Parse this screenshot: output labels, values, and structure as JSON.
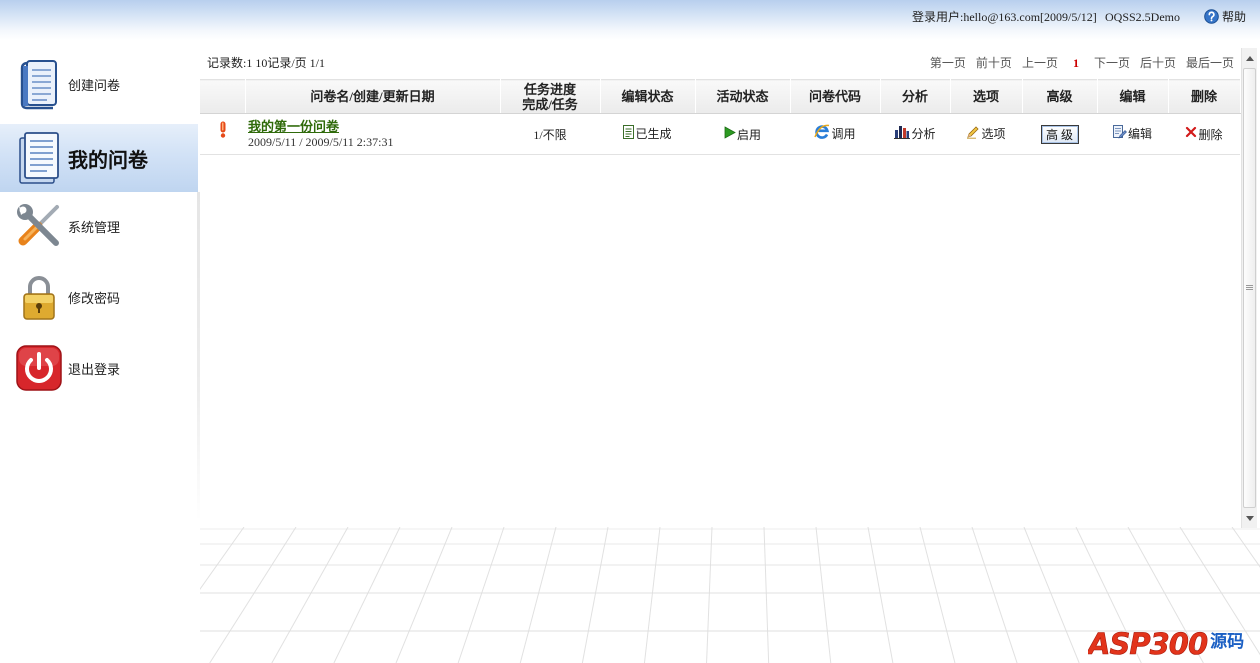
{
  "header": {
    "user_info": "登录用户:hello@163.com[2009/5/12]",
    "product": "OQSS2.5Demo",
    "help_label": "帮助",
    "help_icon": "help-icon"
  },
  "sidebar": {
    "items": [
      {
        "label": "创建问卷",
        "icon": "book-icon"
      },
      {
        "label": "我的问卷",
        "icon": "document-icon",
        "active": true
      },
      {
        "label": "系统管理",
        "icon": "tools-icon"
      },
      {
        "label": "修改密码",
        "icon": "lock-icon"
      },
      {
        "label": "退出登录",
        "icon": "power-icon"
      }
    ]
  },
  "list": {
    "record_info": "记录数:1 10记录/页 1/1",
    "pager": {
      "first": "第一页",
      "prev_ten": "前十页",
      "prev": "上一页",
      "current": "1",
      "next": "下一页",
      "next_ten": "后十页",
      "last": "最后一页"
    },
    "columns": {
      "name": "问卷名/创建/更新日期",
      "progress_line1": "任务进度",
      "progress_line2": "完成/任务",
      "edit_status": "编辑状态",
      "active_status": "活动状态",
      "code": "问卷代码",
      "analysis": "分析",
      "options": "选项",
      "advanced": "高级",
      "edit": "编辑",
      "delete": "删除"
    },
    "rows": [
      {
        "status_icon": "alert-icon",
        "name": "我的第一份问卷",
        "dates": "2009/5/11 / 2009/5/11 2:37:31",
        "progress": "1/不限",
        "edit_status": "已生成",
        "edit_status_icon": "generated-document-icon",
        "active_status": "启用",
        "active_status_icon": "play-icon",
        "code": "调用",
        "code_icon": "ie-icon",
        "analysis": "分析",
        "analysis_icon": "bar-chart-icon",
        "options": "选项",
        "options_icon": "pencil-icon",
        "advanced": "高 级",
        "edit": "编辑",
        "edit_icon": "edit-document-icon",
        "delete": "删除",
        "delete_icon": "delete-x-icon"
      }
    ]
  },
  "logo": {
    "brand": "ASP300",
    "suffix": "源码"
  },
  "colors": {
    "header_blue": "#b8cfee",
    "active_item_blue": "#bfd5f0",
    "link_green": "#2f6a0a",
    "current_page_red": "#cc0000",
    "delete_red": "#d21a1a"
  }
}
